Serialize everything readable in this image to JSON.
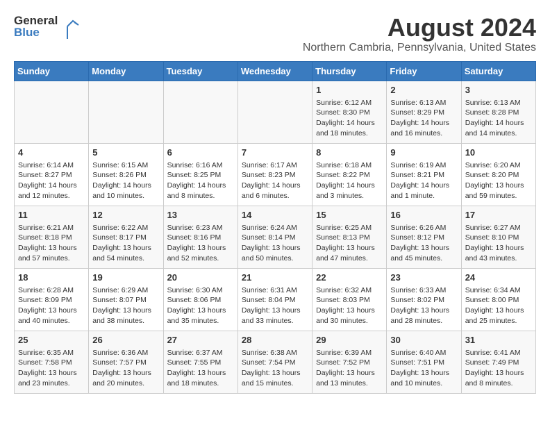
{
  "header": {
    "logo_line1": "General",
    "logo_line2": "Blue",
    "title": "August 2024",
    "subtitle": "Northern Cambria, Pennsylvania, United States"
  },
  "days_of_week": [
    "Sunday",
    "Monday",
    "Tuesday",
    "Wednesday",
    "Thursday",
    "Friday",
    "Saturday"
  ],
  "weeks": [
    [
      {
        "day": "",
        "content": ""
      },
      {
        "day": "",
        "content": ""
      },
      {
        "day": "",
        "content": ""
      },
      {
        "day": "",
        "content": ""
      },
      {
        "day": "1",
        "content": "Sunrise: 6:12 AM\nSunset: 8:30 PM\nDaylight: 14 hours\nand 18 minutes."
      },
      {
        "day": "2",
        "content": "Sunrise: 6:13 AM\nSunset: 8:29 PM\nDaylight: 14 hours\nand 16 minutes."
      },
      {
        "day": "3",
        "content": "Sunrise: 6:13 AM\nSunset: 8:28 PM\nDaylight: 14 hours\nand 14 minutes."
      }
    ],
    [
      {
        "day": "4",
        "content": "Sunrise: 6:14 AM\nSunset: 8:27 PM\nDaylight: 14 hours\nand 12 minutes."
      },
      {
        "day": "5",
        "content": "Sunrise: 6:15 AM\nSunset: 8:26 PM\nDaylight: 14 hours\nand 10 minutes."
      },
      {
        "day": "6",
        "content": "Sunrise: 6:16 AM\nSunset: 8:25 PM\nDaylight: 14 hours\nand 8 minutes."
      },
      {
        "day": "7",
        "content": "Sunrise: 6:17 AM\nSunset: 8:23 PM\nDaylight: 14 hours\nand 6 minutes."
      },
      {
        "day": "8",
        "content": "Sunrise: 6:18 AM\nSunset: 8:22 PM\nDaylight: 14 hours\nand 3 minutes."
      },
      {
        "day": "9",
        "content": "Sunrise: 6:19 AM\nSunset: 8:21 PM\nDaylight: 14 hours\nand 1 minute."
      },
      {
        "day": "10",
        "content": "Sunrise: 6:20 AM\nSunset: 8:20 PM\nDaylight: 13 hours\nand 59 minutes."
      }
    ],
    [
      {
        "day": "11",
        "content": "Sunrise: 6:21 AM\nSunset: 8:18 PM\nDaylight: 13 hours\nand 57 minutes."
      },
      {
        "day": "12",
        "content": "Sunrise: 6:22 AM\nSunset: 8:17 PM\nDaylight: 13 hours\nand 54 minutes."
      },
      {
        "day": "13",
        "content": "Sunrise: 6:23 AM\nSunset: 8:16 PM\nDaylight: 13 hours\nand 52 minutes."
      },
      {
        "day": "14",
        "content": "Sunrise: 6:24 AM\nSunset: 8:14 PM\nDaylight: 13 hours\nand 50 minutes."
      },
      {
        "day": "15",
        "content": "Sunrise: 6:25 AM\nSunset: 8:13 PM\nDaylight: 13 hours\nand 47 minutes."
      },
      {
        "day": "16",
        "content": "Sunrise: 6:26 AM\nSunset: 8:12 PM\nDaylight: 13 hours\nand 45 minutes."
      },
      {
        "day": "17",
        "content": "Sunrise: 6:27 AM\nSunset: 8:10 PM\nDaylight: 13 hours\nand 43 minutes."
      }
    ],
    [
      {
        "day": "18",
        "content": "Sunrise: 6:28 AM\nSunset: 8:09 PM\nDaylight: 13 hours\nand 40 minutes."
      },
      {
        "day": "19",
        "content": "Sunrise: 6:29 AM\nSunset: 8:07 PM\nDaylight: 13 hours\nand 38 minutes."
      },
      {
        "day": "20",
        "content": "Sunrise: 6:30 AM\nSunset: 8:06 PM\nDaylight: 13 hours\nand 35 minutes."
      },
      {
        "day": "21",
        "content": "Sunrise: 6:31 AM\nSunset: 8:04 PM\nDaylight: 13 hours\nand 33 minutes."
      },
      {
        "day": "22",
        "content": "Sunrise: 6:32 AM\nSunset: 8:03 PM\nDaylight: 13 hours\nand 30 minutes."
      },
      {
        "day": "23",
        "content": "Sunrise: 6:33 AM\nSunset: 8:02 PM\nDaylight: 13 hours\nand 28 minutes."
      },
      {
        "day": "24",
        "content": "Sunrise: 6:34 AM\nSunset: 8:00 PM\nDaylight: 13 hours\nand 25 minutes."
      }
    ],
    [
      {
        "day": "25",
        "content": "Sunrise: 6:35 AM\nSunset: 7:58 PM\nDaylight: 13 hours\nand 23 minutes."
      },
      {
        "day": "26",
        "content": "Sunrise: 6:36 AM\nSunset: 7:57 PM\nDaylight: 13 hours\nand 20 minutes."
      },
      {
        "day": "27",
        "content": "Sunrise: 6:37 AM\nSunset: 7:55 PM\nDaylight: 13 hours\nand 18 minutes."
      },
      {
        "day": "28",
        "content": "Sunrise: 6:38 AM\nSunset: 7:54 PM\nDaylight: 13 hours\nand 15 minutes."
      },
      {
        "day": "29",
        "content": "Sunrise: 6:39 AM\nSunset: 7:52 PM\nDaylight: 13 hours\nand 13 minutes."
      },
      {
        "day": "30",
        "content": "Sunrise: 6:40 AM\nSunset: 7:51 PM\nDaylight: 13 hours\nand 10 minutes."
      },
      {
        "day": "31",
        "content": "Sunrise: 6:41 AM\nSunset: 7:49 PM\nDaylight: 13 hours\nand 8 minutes."
      }
    ]
  ]
}
